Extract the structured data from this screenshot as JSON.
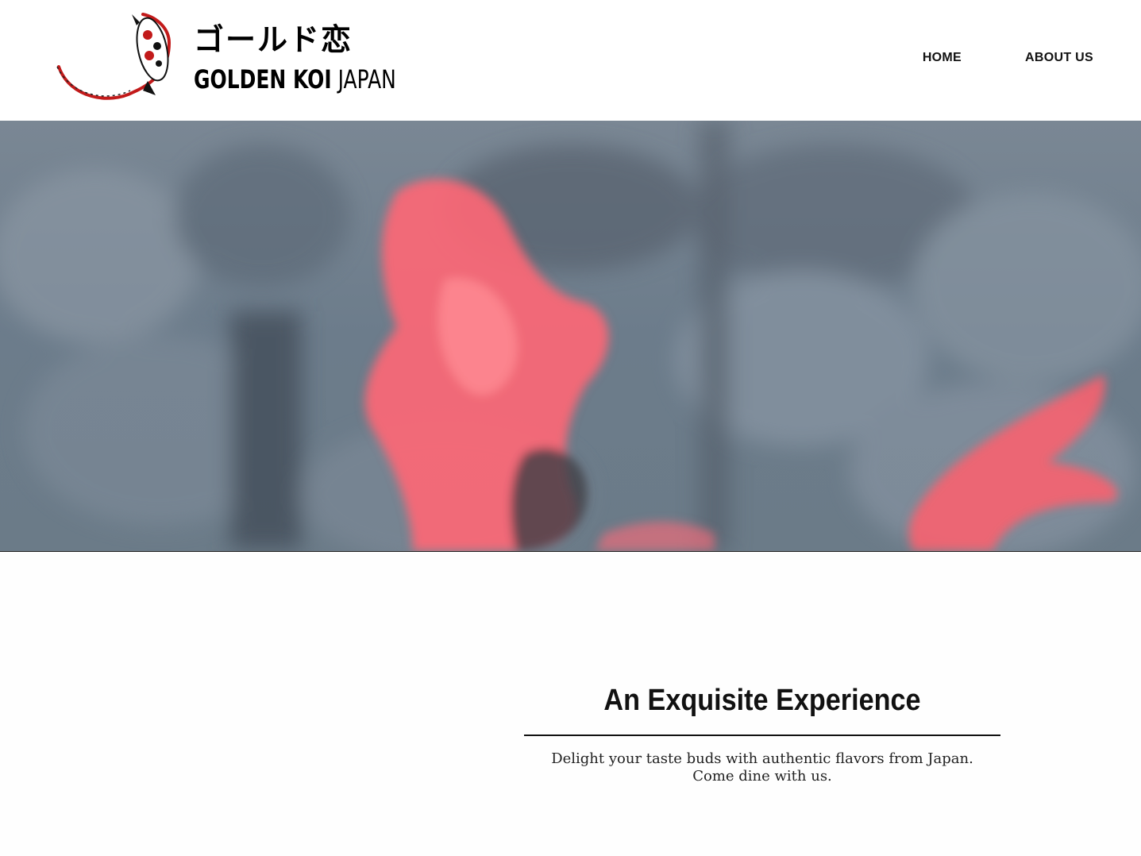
{
  "header": {
    "logo": {
      "japanese_text": "ゴールド恋",
      "brand_bold": "GOLDEN KOI",
      "brand_light": "JAPAN",
      "icon": "koi-fish-icon"
    },
    "nav": [
      {
        "label": "HOME"
      },
      {
        "label": "ABOUT US"
      }
    ]
  },
  "hero": {
    "description_icon": "koi-pond-image"
  },
  "main": {
    "headline": "An Exquisite Experience",
    "tagline": "Delight your taste buds with authentic flavors from Japan. Come dine with us."
  },
  "colors": {
    "koi_red": "#ff5b6b",
    "water": "#6f7f8d",
    "text": "#111111"
  }
}
